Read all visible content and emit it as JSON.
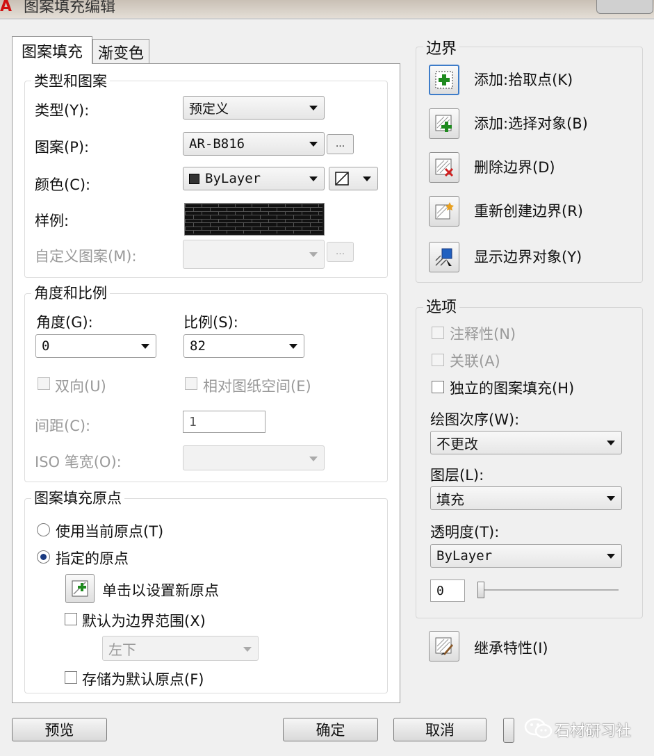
{
  "window": {
    "title": "图案填充编辑"
  },
  "tabs": [
    {
      "label": "图案填充"
    },
    {
      "label": "渐变色"
    }
  ],
  "type_pattern": {
    "title": "类型和图案",
    "type_label": "类型(Y):",
    "type_value": "预定义",
    "pattern_label": "图案(P):",
    "pattern_value": "AR-B816",
    "pattern_browse": "...",
    "color_label": "颜色(C):",
    "color_value": "ByLayer",
    "swatch_label": "样例:",
    "custom_label": "自定义图案(M):",
    "custom_value": "",
    "custom_browse": "..."
  },
  "angle_scale": {
    "title": "角度和比例",
    "angle_label": "角度(G):",
    "angle_value": "0",
    "scale_label": "比例(S):",
    "scale_value": "82",
    "double_label": "双向(U)",
    "relative_label": "相对图纸空间(E)",
    "spacing_label": "间距(C):",
    "spacing_value": "1",
    "iso_label": "ISO 笔宽(O):",
    "iso_value": ""
  },
  "origin": {
    "title": "图案填充原点",
    "use_current_label": "使用当前原点(T)",
    "specified_label": "指定的原点",
    "click_set_label": "单击以设置新原点",
    "default_extent_label": "默认为边界范围(X)",
    "position_value": "左下",
    "store_default_label": "存储为默认原点(F)"
  },
  "boundary": {
    "title": "边界",
    "add_pick": "添加:拾取点(K)",
    "add_select": "添加:选择对象(B)",
    "remove": "删除边界(D)",
    "recreate": "重新创建边界(R)",
    "show": "显示边界对象(Y)"
  },
  "options": {
    "title": "选项",
    "annotative": "注释性(N)",
    "associative": "关联(A)",
    "separate": "独立的图案填充(H)",
    "draw_order_label": "绘图次序(W):",
    "draw_order_value": "不更改",
    "layer_label": "图层(L):",
    "layer_value": "填充",
    "transparency_label": "透明度(T):",
    "transparency_value": "ByLayer",
    "transparency_level": "0"
  },
  "inherit": {
    "label": "继承特性(I)"
  },
  "footer": {
    "preview": "预览",
    "ok": "确定",
    "cancel": "取消",
    "watermark": "石材研习社"
  },
  "colors": {
    "accent": "#3d7cc9",
    "pattern": "#111111",
    "add_green": "#1f8a1f",
    "remove_red": "#d02020"
  },
  "icons": [
    "autocad-logo-icon",
    "pick-point-icon",
    "select-objects-icon",
    "remove-boundary-icon",
    "recreate-boundary-icon",
    "show-boundary-icon",
    "set-origin-icon",
    "inherit-properties-icon",
    "wechat-icon"
  ]
}
